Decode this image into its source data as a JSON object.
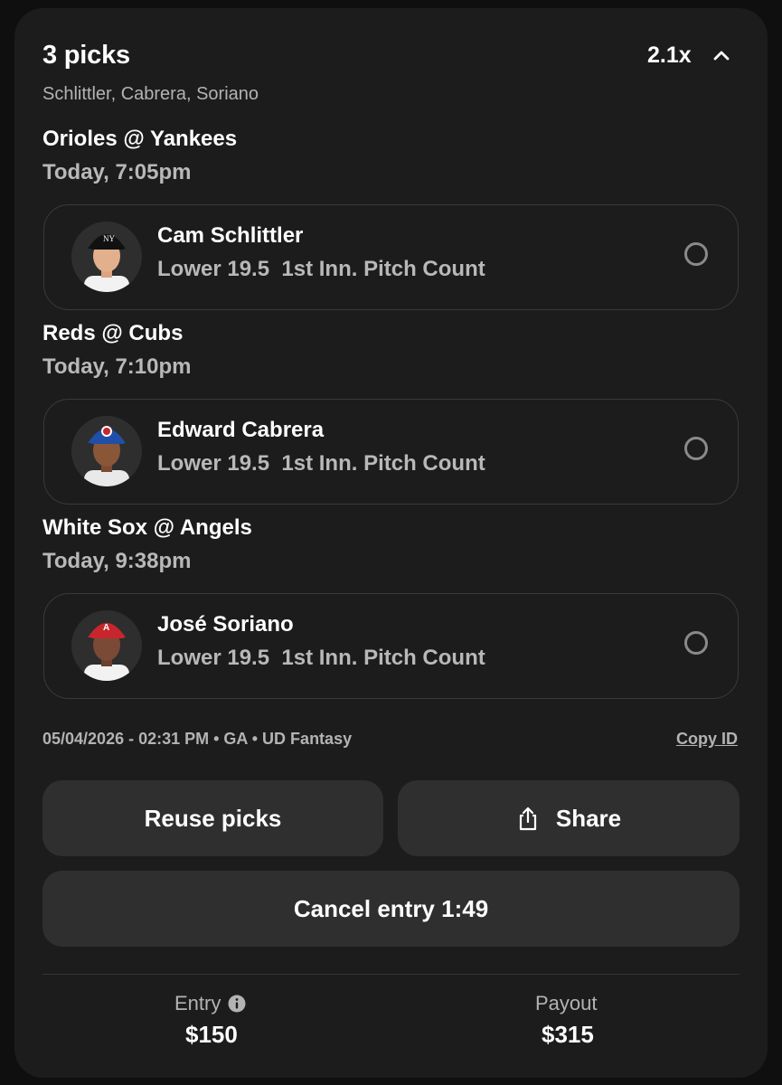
{
  "header": {
    "title": "3 picks",
    "multiplier": "2.1x",
    "players_summary": "Schlittler, Cabrera, Soriano"
  },
  "games": [
    {
      "matchup": "Orioles @ Yankees",
      "time": "Today, 7:05pm",
      "pick": {
        "player": "Cam Schlittler",
        "line": "Lower 19.5  1st Inn. Pitch Count",
        "cap_color": "#111111",
        "jersey_color": "#f2f2f2"
      }
    },
    {
      "matchup": "Reds @ Cubs",
      "time": "Today, 7:10pm",
      "pick": {
        "player": "Edward Cabrera",
        "line": "Lower 19.5  1st Inn. Pitch Count",
        "cap_color": "#1f4fa8",
        "jersey_color": "#e9e9e9"
      }
    },
    {
      "matchup": "White Sox @ Angels",
      "time": "Today, 9:38pm",
      "pick": {
        "player": "José Soriano",
        "line": "Lower 19.5  1st Inn. Pitch Count",
        "cap_color": "#c8262d",
        "jersey_color": "#f2f2f2"
      }
    }
  ],
  "meta": {
    "info": "05/04/2026 - 02:31 PM • GA • UD Fantasy",
    "copy_id": "Copy ID"
  },
  "actions": {
    "reuse": "Reuse picks",
    "share": "Share",
    "cancel": "Cancel entry 1:49"
  },
  "summary": {
    "entry_label": "Entry",
    "entry_value": "$150",
    "payout_label": "Payout",
    "payout_value": "$315"
  },
  "icons": {
    "collapse": "chevron-up-icon",
    "select": "radio-circle-icon",
    "share": "share-icon",
    "info": "info-icon"
  }
}
